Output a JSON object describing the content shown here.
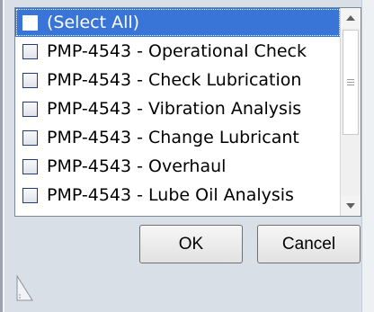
{
  "filter_list": {
    "items": [
      {
        "label": "(Select All)",
        "checked": false,
        "selected": true
      },
      {
        "label": "PMP-4543 - Operational Check",
        "checked": false,
        "selected": false
      },
      {
        "label": "PMP-4543 - Check Lubrication",
        "checked": false,
        "selected": false
      },
      {
        "label": "PMP-4543 - Vibration Analysis",
        "checked": false,
        "selected": false
      },
      {
        "label": "PMP-4543 - Change Lubricant",
        "checked": false,
        "selected": false
      },
      {
        "label": "PMP-4543 - Overhaul",
        "checked": false,
        "selected": false
      },
      {
        "label": "PMP-4543 - Lube Oil Analysis",
        "checked": false,
        "selected": false
      }
    ]
  },
  "buttons": {
    "ok_label": "OK",
    "cancel_label": "Cancel"
  },
  "colors": {
    "selection": "#3875d7",
    "panel_background": "#d9dfe6"
  },
  "icons": {
    "scroll_up": "chevron-up-icon",
    "scroll_down": "chevron-down-icon",
    "thumb_grip": "grip-icon",
    "resize": "resize-grip-icon"
  }
}
